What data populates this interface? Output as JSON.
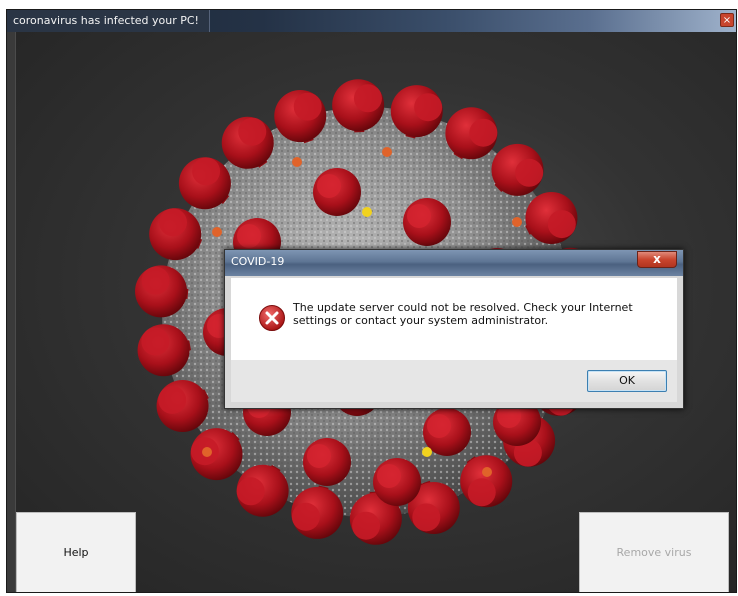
{
  "window": {
    "title": "coronavirus has infected your PC!",
    "close_label": "×"
  },
  "dialog": {
    "title": "COVID-19",
    "close_label": "x",
    "message": "The update server could not be resolved. Check your Internet settings or contact your system administrator.",
    "ok_label": "OK",
    "icon": "error-icon"
  },
  "buttons": {
    "help_label": "Help",
    "remove_label": "Remove virus",
    "remove_enabled": false
  },
  "colors": {
    "virus_spike": "#b8141f",
    "virus_body": "#9a9a9a",
    "accent_orange": "#e0632a",
    "accent_yellow": "#f1d21e",
    "error_red": "#c82222"
  }
}
